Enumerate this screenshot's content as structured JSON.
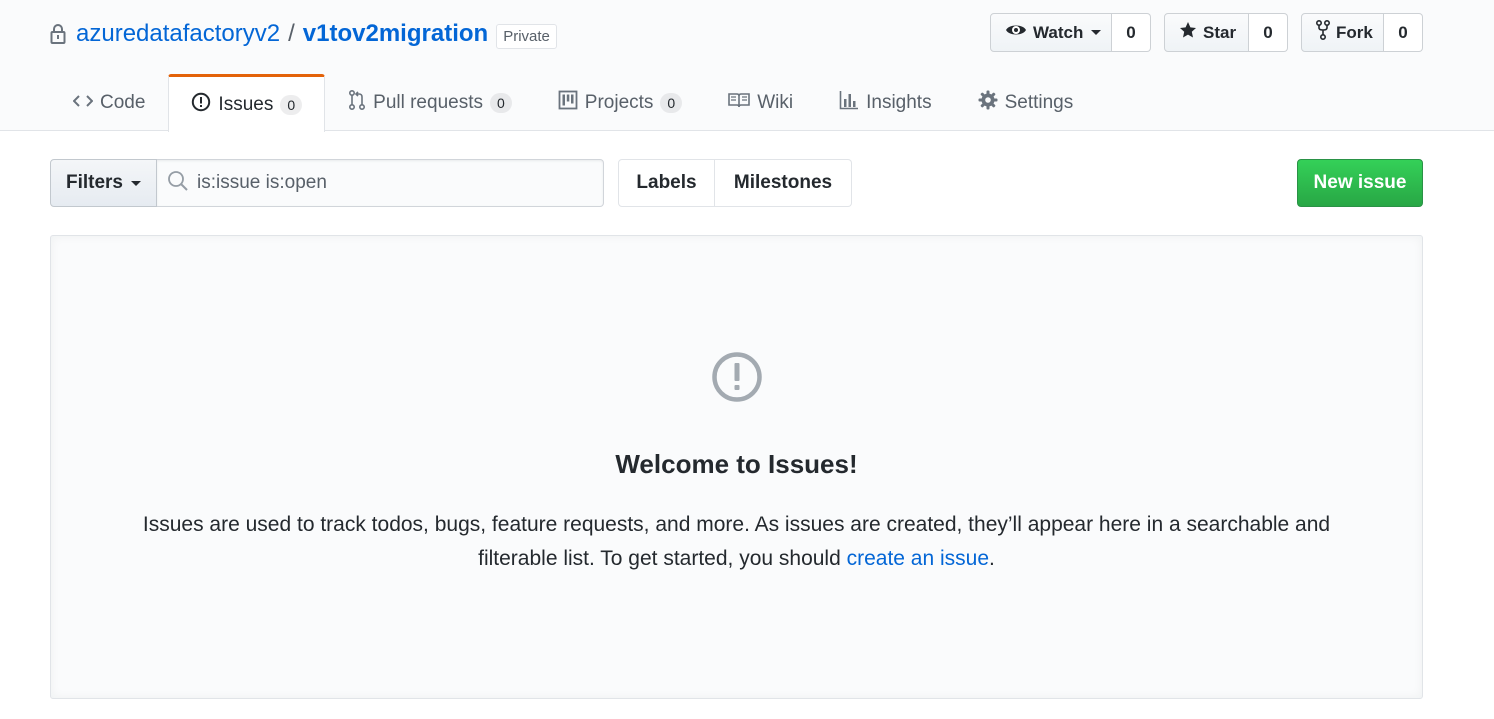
{
  "repo": {
    "owner": "azuredatafactoryv2",
    "separator": "/",
    "name": "v1tov2migration",
    "visibility": "Private"
  },
  "actions": {
    "watch": {
      "label": "Watch",
      "count": "0"
    },
    "star": {
      "label": "Star",
      "count": "0"
    },
    "fork": {
      "label": "Fork",
      "count": "0"
    }
  },
  "tabs": [
    {
      "label": "Code",
      "icon": "code-icon"
    },
    {
      "label": "Issues",
      "icon": "issue-opened-icon",
      "count": "0",
      "selected": true
    },
    {
      "label": "Pull requests",
      "icon": "git-pull-request-icon",
      "count": "0"
    },
    {
      "label": "Projects",
      "icon": "project-icon",
      "count": "0"
    },
    {
      "label": "Wiki",
      "icon": "book-icon"
    },
    {
      "label": "Insights",
      "icon": "graph-icon"
    },
    {
      "label": "Settings",
      "icon": "gear-icon"
    }
  ],
  "subnav": {
    "filters_label": "Filters",
    "search_value": "is:issue is:open",
    "labels_label": "Labels",
    "milestones_label": "Milestones",
    "new_issue_label": "New issue"
  },
  "blankslate": {
    "title": "Welcome to Issues!",
    "text_before": "Issues are used to track todos, bugs, feature requests, and more. As issues are created, they’ll appear here in a searchable and filterable list. To get started, you should ",
    "link_text": "create an issue",
    "text_after": "."
  },
  "colors": {
    "link": "#0366d6",
    "selected_tab_accent": "#e36209",
    "primary_button": "#28a745"
  }
}
